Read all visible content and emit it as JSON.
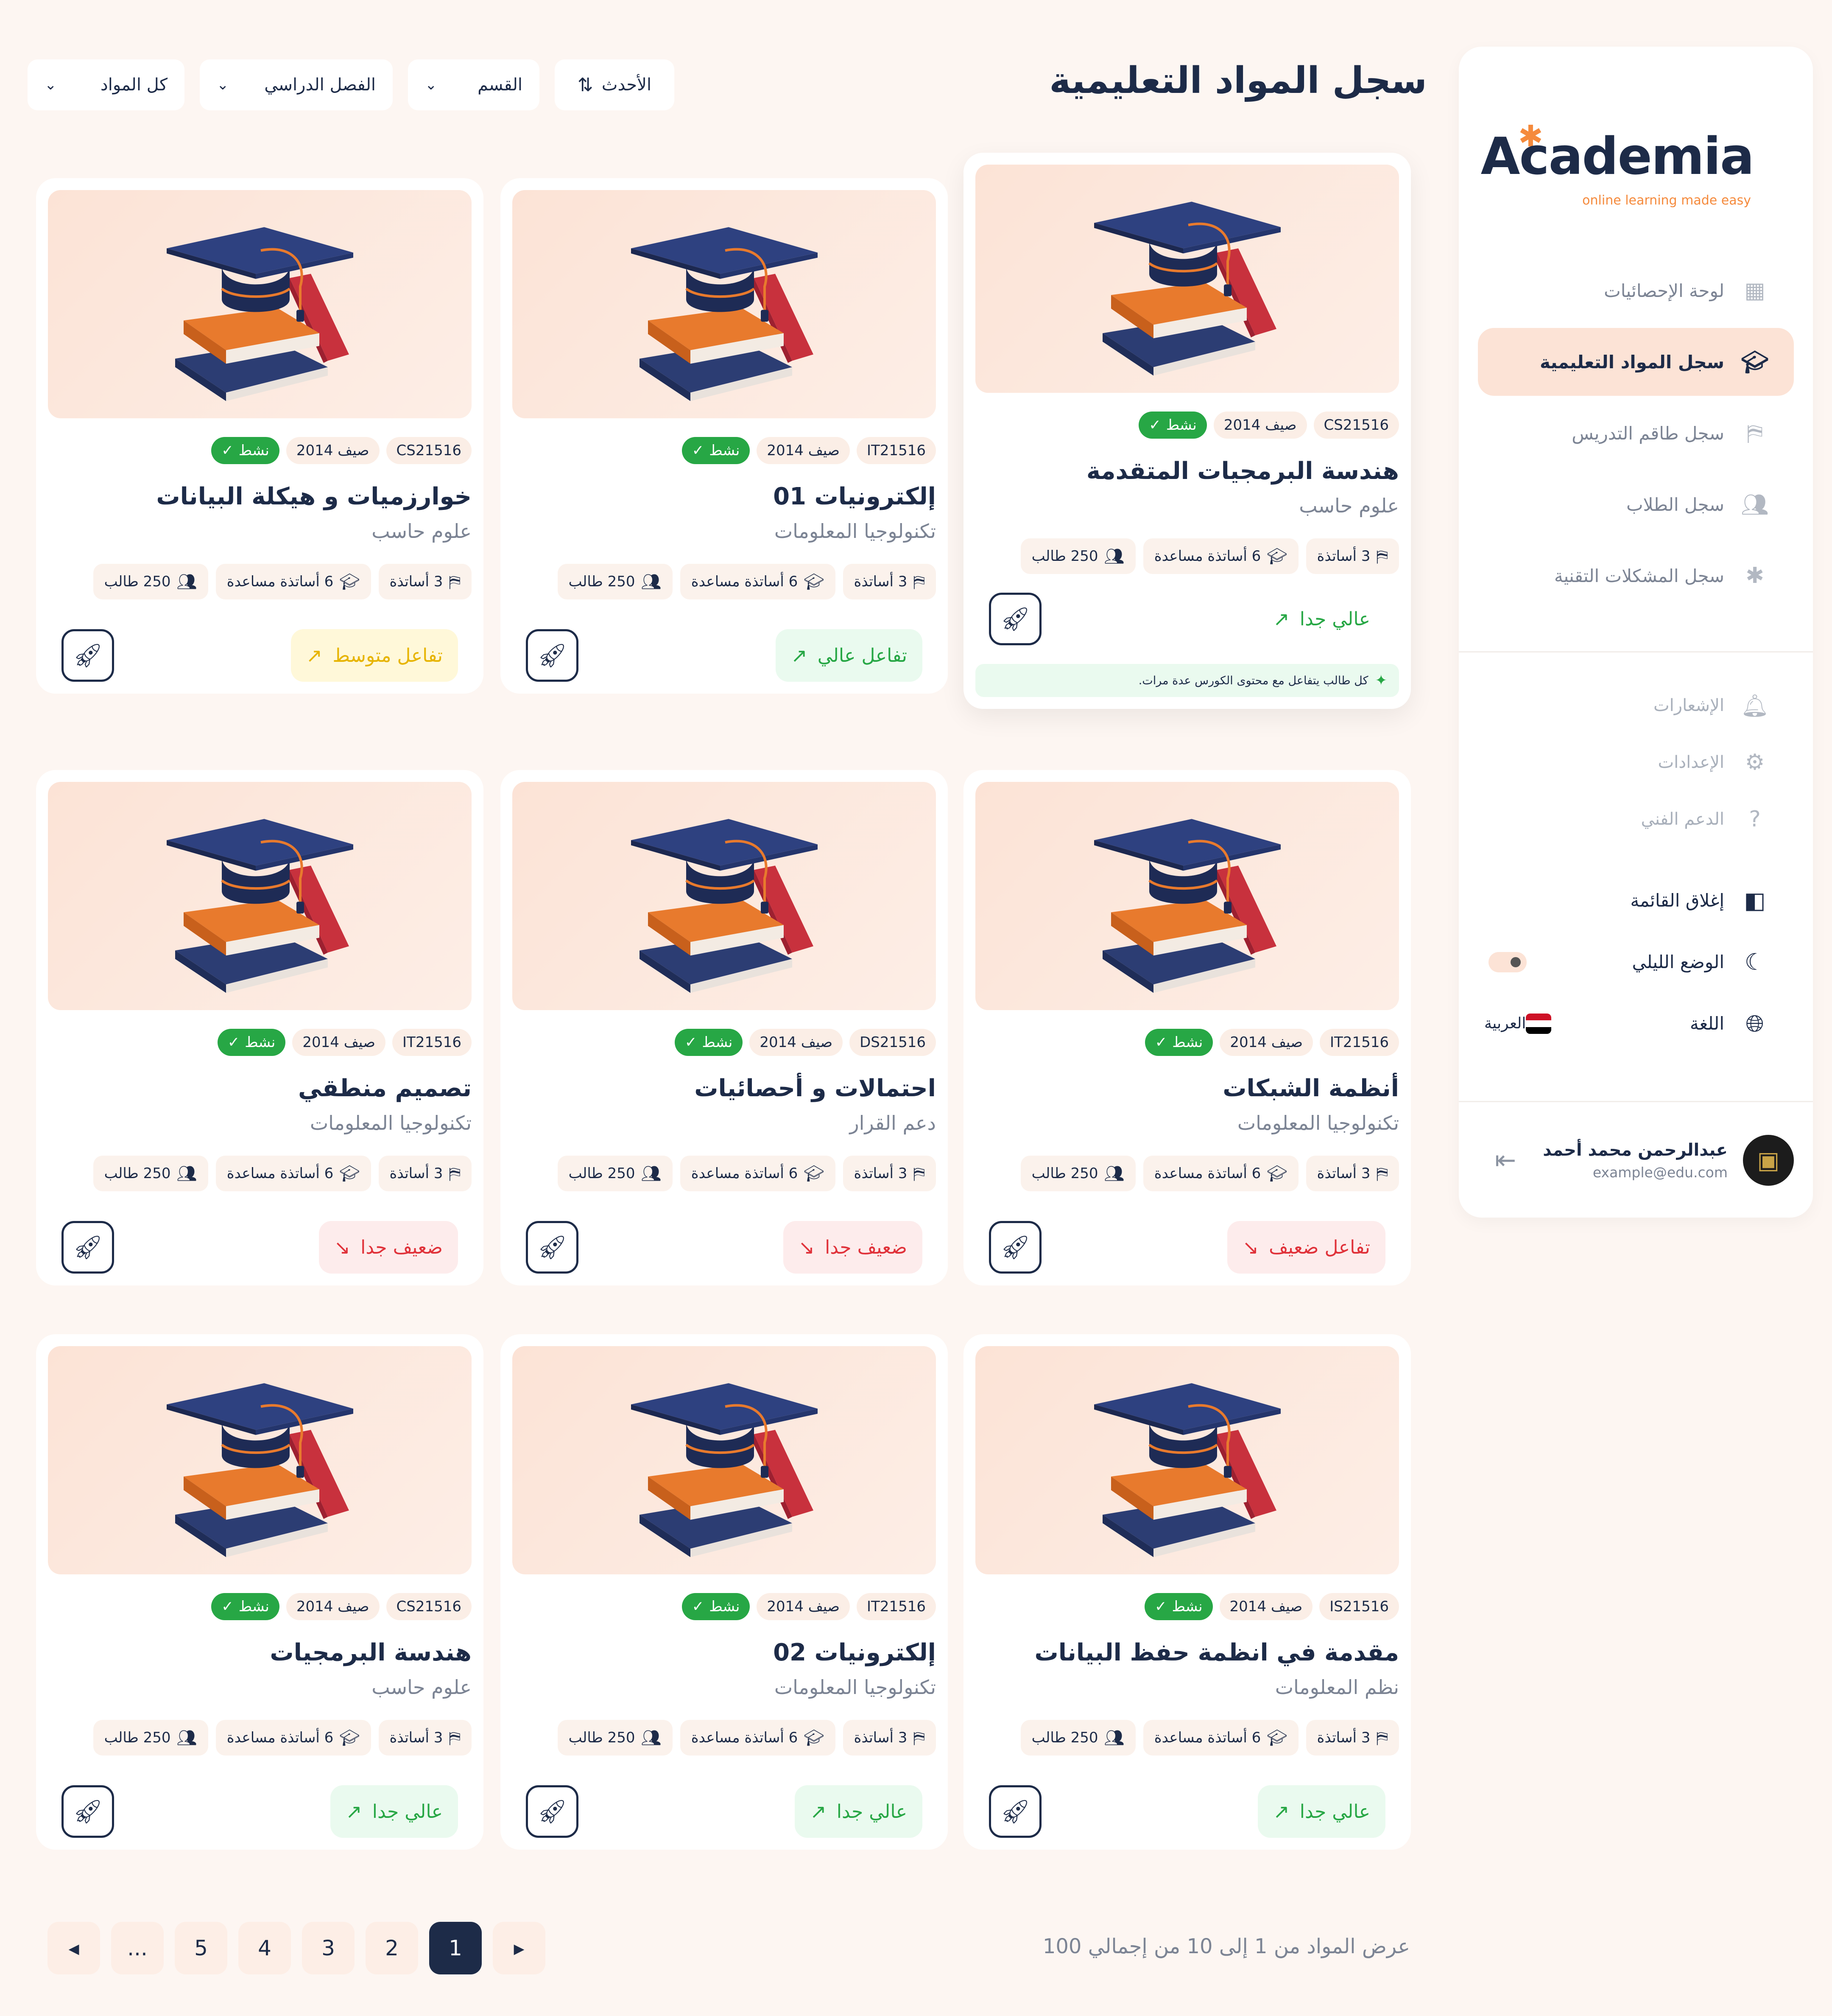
{
  "brand": {
    "name": "Academia",
    "tagline": "online learning made easy"
  },
  "sidebar": {
    "items": [
      {
        "label": "لوحة الإحصائيات",
        "icon": "dashboard-icon",
        "active": false
      },
      {
        "label": "سجل المواد التعليمية",
        "icon": "graduation-cap-icon",
        "active": true
      },
      {
        "label": "سجل طاقم التدريس",
        "icon": "teacher-board-icon",
        "active": false
      },
      {
        "label": "سجل الطلاب",
        "icon": "users-icon",
        "active": false
      },
      {
        "label": "سجل المشكلات التقنية",
        "icon": "bug-icon",
        "active": false
      }
    ],
    "secondary": [
      {
        "label": "الإشعارات",
        "icon": "bell-icon"
      },
      {
        "label": "الإعدادات",
        "icon": "gear-icon"
      },
      {
        "label": "الدعم الفني",
        "icon": "help-icon"
      }
    ],
    "collapse_label": "إغلاق القائمة",
    "dark_mode_label": "الوضع الليلي",
    "language_label": "اللغة",
    "language_value": "العربية",
    "user": {
      "name": "عبدالرحمن محمد أحمد",
      "email": "example@edu.com"
    }
  },
  "header": {
    "title": "سجل المواد التعليمية",
    "filters": [
      {
        "label": "كل المواد"
      },
      {
        "label": "الفصل الدراسي"
      },
      {
        "label": "القسم"
      }
    ],
    "sort_label": "الأحدث"
  },
  "labels": {
    "active": "نشط",
    "teachers": "3 أساتذة",
    "assistants": "6 أساتذة مساعدة",
    "students": "250 طالب",
    "season": "صيف 2014"
  },
  "colors": {
    "navy": "#1d2b48",
    "accent_peach": "#fce3d6",
    "green": "#27a745",
    "red": "#e0323a",
    "yellow": "#e7b400",
    "orange": "#f58a3c"
  },
  "courses": [
    {
      "code": "CS21516",
      "title": "هندسة البرمجيات المتقدمة",
      "dept": "علوم حاسب",
      "engagement": "عالي جدا",
      "level": "plain",
      "trend": "up",
      "hint": "كل طالب يتفاعل مع محتوى الكورس عدة مرات."
    },
    {
      "code": "IT21516",
      "title": "إلكترونيات 01",
      "dept": "تكنولوجيا المعلومات",
      "engagement": "تفاعل عالي",
      "level": "green",
      "trend": "up"
    },
    {
      "code": "CS21516",
      "title": "خوارزميات و هيكلة البيانات",
      "dept": "علوم حاسب",
      "engagement": "تفاعل متوسط",
      "level": "yellow",
      "trend": "up"
    },
    {
      "code": "IT21516",
      "title": "أنظمة الشبكات",
      "dept": "تكنولوجيا المعلومات",
      "engagement": "تفاعل ضعيف",
      "level": "red",
      "trend": "down"
    },
    {
      "code": "DS21516",
      "title": "احتمالات و أحصائيات",
      "dept": "دعم القرار",
      "engagement": "ضعيف جدا",
      "level": "red",
      "trend": "down"
    },
    {
      "code": "IT21516",
      "title": "تصميم منطقي",
      "dept": "تكنولوجيا المعلومات",
      "engagement": "ضعيف جدا",
      "level": "red",
      "trend": "down"
    },
    {
      "code": "IS21516",
      "title": "مقدمة في انظمة حفظ البيانات",
      "dept": "نظم المعلومات",
      "engagement": "عالي جدا",
      "level": "green",
      "trend": "up"
    },
    {
      "code": "IT21516",
      "title": "إلكترونيات 02",
      "dept": "تكنولوجيا المعلومات",
      "engagement": "عالي جدا",
      "level": "green",
      "trend": "up"
    },
    {
      "code": "CS21516",
      "title": "هندسة البرمجيات",
      "dept": "علوم حاسب",
      "engagement": "عالي جدا",
      "level": "green",
      "trend": "up"
    }
  ],
  "pagination": {
    "info": "عرض المواد من 1 إلى 10 من إجمالي 100",
    "pages": [
      "1",
      "2",
      "3",
      "4",
      "5",
      "..."
    ],
    "current": "1"
  }
}
